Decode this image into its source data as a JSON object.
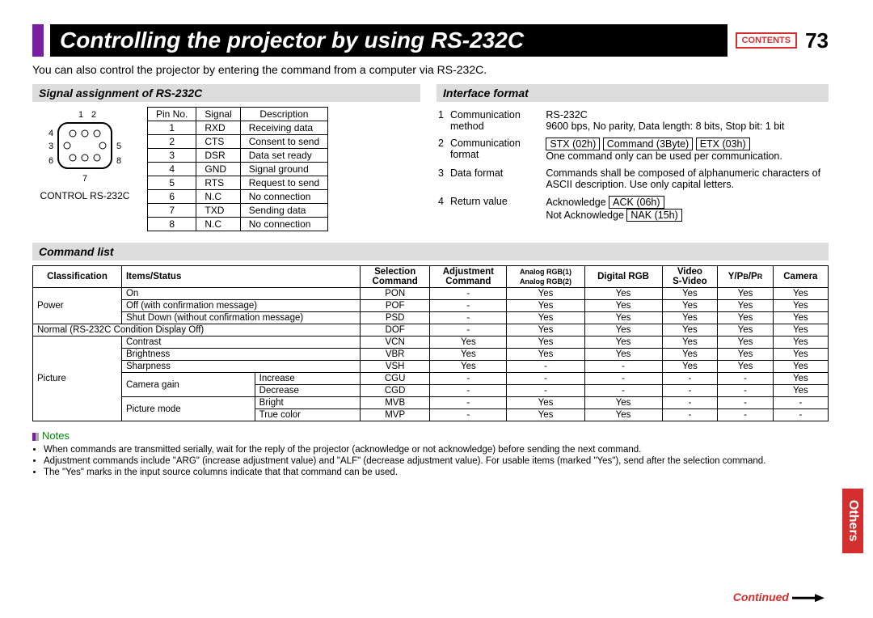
{
  "header": {
    "title": "Controlling the projector by using RS-232C",
    "contents_btn": "CONTENTS",
    "page_number": "73"
  },
  "intro": "You can also control the projector by entering the command from a computer via RS-232C.",
  "signal": {
    "heading": "Signal assignment of RS-232C",
    "connector_label": "CONTROL RS-232C",
    "pin_numbers": [
      "1",
      "2",
      "3",
      "4",
      "5",
      "6",
      "7",
      "8"
    ],
    "table_headers": [
      "Pin No.",
      "Signal",
      "Description"
    ],
    "rows": [
      [
        "1",
        "RXD",
        "Receiving data"
      ],
      [
        "2",
        "CTS",
        "Consent to send"
      ],
      [
        "3",
        "DSR",
        "Data set ready"
      ],
      [
        "4",
        "GND",
        "Signal ground"
      ],
      [
        "5",
        "RTS",
        "Request to send"
      ],
      [
        "6",
        "N.C",
        "No connection"
      ],
      [
        "7",
        "TXD",
        "Sending data"
      ],
      [
        "8",
        "N.C",
        "No connection"
      ]
    ]
  },
  "interface": {
    "heading": "Interface format",
    "rows": [
      {
        "n": "1",
        "label": "Communication method",
        "val": "RS-232C",
        "extra": "9600 bps, No parity, Data length: 8 bits, Stop bit: 1 bit"
      },
      {
        "n": "2",
        "label": "Communication format",
        "boxes": [
          "STX (02h)",
          "Command (3Byte)",
          "ETX (03h)"
        ],
        "extra": "One command only can be used per communication."
      },
      {
        "n": "3",
        "label": "Data format",
        "val": "Commands shall be composed of alphanumeric characters of ASCII description. Use only capital letters."
      },
      {
        "n": "4",
        "label": "Return value",
        "ack": "Acknowledge",
        "ack_box": "ACK (06h)",
        "nak": "Not Acknowledge",
        "nak_box": "NAK (15h)"
      }
    ]
  },
  "cmd": {
    "heading": "Command list",
    "headers": [
      "Classification",
      "Items/Status",
      "Selection Command",
      "Adjustment Command",
      "Analog RGB(1) Analog RGB(2)",
      "Digital RGB",
      "Video S-Video",
      "Y/PB/PR",
      "Camera"
    ],
    "rows": [
      {
        "cls": "Power",
        "item": "On",
        "sub": "",
        "sel": "PON",
        "adj": "-",
        "c1": "Yes",
        "c2": "Yes",
        "c3": "Yes",
        "c4": "Yes",
        "c5": "Yes"
      },
      {
        "cls": "",
        "item": "Off (with confirmation message)",
        "sub": "",
        "sel": "POF",
        "adj": "-",
        "c1": "Yes",
        "c2": "Yes",
        "c3": "Yes",
        "c4": "Yes",
        "c5": "Yes"
      },
      {
        "cls": "",
        "item": "Shut Down (without confirmation message)",
        "sub": "",
        "sel": "PSD",
        "adj": "-",
        "c1": "Yes",
        "c2": "Yes",
        "c3": "Yes",
        "c4": "Yes",
        "c5": "Yes"
      },
      {
        "cls": "",
        "item": "Normal (RS-232C Condition Display Off)",
        "sub": "",
        "sel": "DOF",
        "adj": "-",
        "c1": "Yes",
        "c2": "Yes",
        "c3": "Yes",
        "c4": "Yes",
        "c5": "Yes",
        "span": "2"
      },
      {
        "cls": "Picture",
        "item": "Contrast",
        "sub": "",
        "sel": "VCN",
        "adj": "Yes",
        "c1": "Yes",
        "c2": "Yes",
        "c3": "Yes",
        "c4": "Yes",
        "c5": "Yes"
      },
      {
        "cls": "",
        "item": "Brightness",
        "sub": "",
        "sel": "VBR",
        "adj": "Yes",
        "c1": "Yes",
        "c2": "Yes",
        "c3": "Yes",
        "c4": "Yes",
        "c5": "Yes"
      },
      {
        "cls": "",
        "item": "Sharpness",
        "sub": "",
        "sel": "VSH",
        "adj": "Yes",
        "c1": "-",
        "c2": "-",
        "c3": "Yes",
        "c4": "Yes",
        "c5": "Yes"
      },
      {
        "cls": "",
        "item": "Camera gain",
        "sub": "Increase",
        "sel": "CGU",
        "adj": "-",
        "c1": "-",
        "c2": "-",
        "c3": "-",
        "c4": "-",
        "c5": "Yes"
      },
      {
        "cls": "",
        "item": "",
        "sub": "Decrease",
        "sel": "CGD",
        "adj": "-",
        "c1": "-",
        "c2": "-",
        "c3": "-",
        "c4": "-",
        "c5": "Yes"
      },
      {
        "cls": "",
        "item": "Picture mode",
        "sub": "Bright",
        "sel": "MVB",
        "adj": "-",
        "c1": "Yes",
        "c2": "Yes",
        "c3": "-",
        "c4": "-",
        "c5": "-"
      },
      {
        "cls": "",
        "item": "",
        "sub": "True color",
        "sel": "MVP",
        "adj": "-",
        "c1": "Yes",
        "c2": "Yes",
        "c3": "-",
        "c4": "-",
        "c5": "-"
      }
    ]
  },
  "notes": {
    "heading": "Notes",
    "items": [
      "When commands are transmitted serially, wait for the reply of the projector (acknowledge or not acknowledge) before sending the next command.",
      "Adjustment commands include \"ARG\" (increase adjustment value) and \"ALF\" (decrease adjustment value). For usable items (marked \"Yes\"), send after the selection command.",
      "The \"Yes\" marks in the input source columns indicate that that command can be used."
    ]
  },
  "side_tab": "Others",
  "continued": "Continued"
}
